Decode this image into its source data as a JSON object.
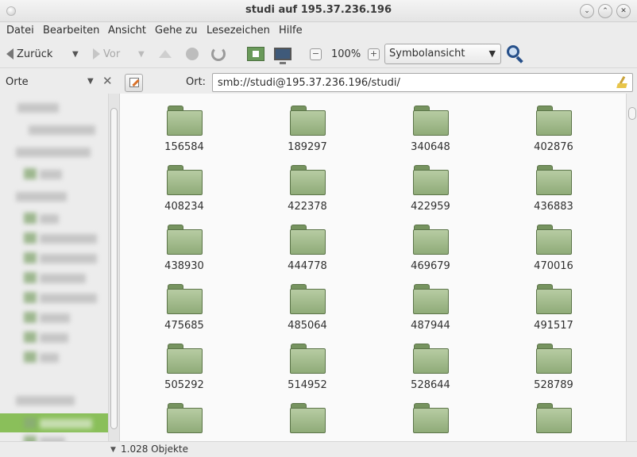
{
  "window": {
    "title": "studi auf 195.37.236.196"
  },
  "menu": [
    "Datei",
    "Bearbeiten",
    "Ansicht",
    "Gehe zu",
    "Lesezeichen",
    "Hilfe"
  ],
  "toolbar": {
    "back_label": "Zurück",
    "forward_label": "Vor",
    "zoom_level": "100%",
    "view_mode": "Symbolansicht"
  },
  "sidebar": {
    "header": "Orte"
  },
  "location": {
    "label": "Ort:",
    "value": "smb://studi@195.37.236.196/studi/"
  },
  "folders": [
    "156584",
    "189297",
    "340648",
    "402876",
    "408234",
    "422378",
    "422959",
    "436883",
    "438930",
    "444778",
    "469679",
    "470016",
    "475685",
    "485064",
    "487944",
    "491517",
    "505292",
    "514952",
    "528644",
    "528789",
    "",
    "",
    "",
    ""
  ],
  "status": {
    "count": "1.028 Objekte"
  },
  "colors": {
    "folder": "#8fab78",
    "selection": "#8abf5a",
    "zoom_icon": "#27508a"
  }
}
